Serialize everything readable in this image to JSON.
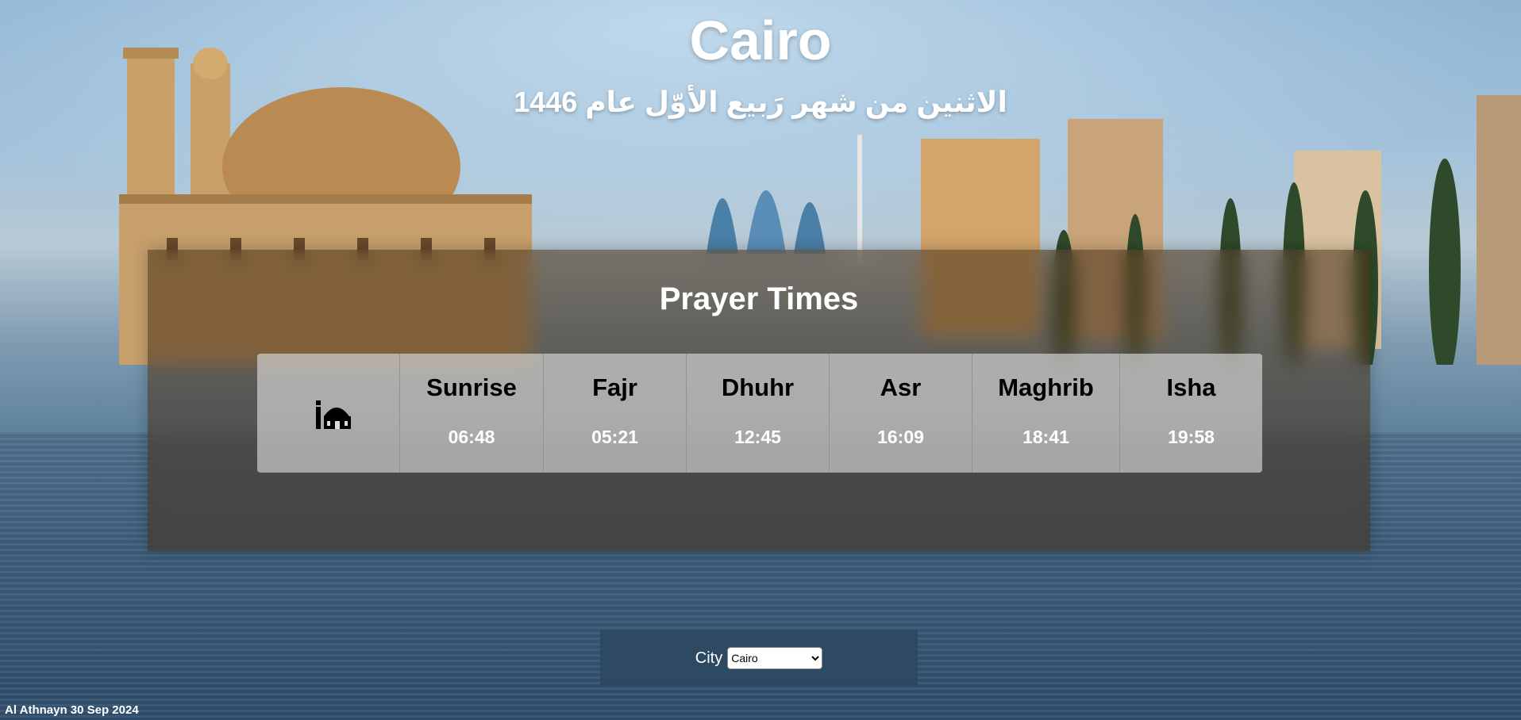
{
  "header": {
    "city_name": "Cairo",
    "hijri_date": "الاثنين من شهر رَبيع الأوّل عام 1446"
  },
  "prayer_panel": {
    "title": "Prayer Times",
    "icon": "mosque-icon",
    "prayers": [
      {
        "name": "Sunrise",
        "time": "06:48"
      },
      {
        "name": "Fajr",
        "time": "05:21"
      },
      {
        "name": "Dhuhr",
        "time": "12:45"
      },
      {
        "name": "Asr",
        "time": "16:09"
      },
      {
        "name": "Maghrib",
        "time": "18:41"
      },
      {
        "name": "Isha",
        "time": "19:58"
      }
    ]
  },
  "city_selector": {
    "label": "City",
    "selected": "Cairo"
  },
  "footer": {
    "gregorian_date": "Al Athnayn 30 Sep 2024"
  },
  "colors": {
    "panel_bg": "#46301a",
    "table_bg": "#e1e1e1",
    "city_bar_bg": "#2d465f"
  }
}
